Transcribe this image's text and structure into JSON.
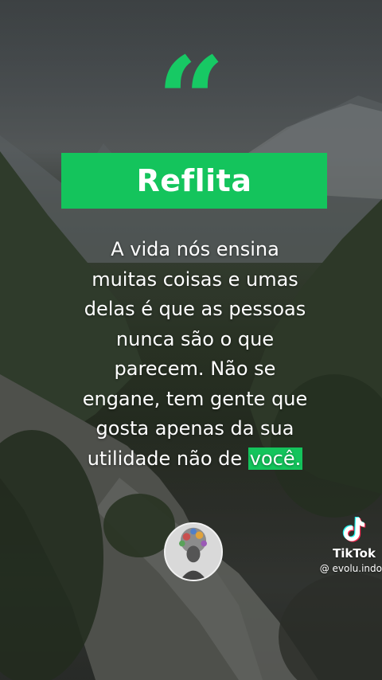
{
  "quote_mark": "“",
  "banner": {
    "title": "Reflita"
  },
  "quote": {
    "lines": [
      "A vida nós ensina",
      "muitas coisas e umas",
      "delas é que as pessoas",
      "nunca são o que",
      "parecem. Não se",
      "engane, tem gente que",
      "gosta apenas da sua"
    ],
    "last_line_prefix": "utilidade não de ",
    "highlighted_word": "você."
  },
  "tiktok": {
    "name": "TikTok",
    "handle": "@ evolu.indo"
  },
  "colors": {
    "accent": "#14c45c",
    "text": "#ffffff"
  },
  "icons": {
    "logo": "tiktok-logo-icon",
    "avatar": "avatar-portrait-icon"
  }
}
